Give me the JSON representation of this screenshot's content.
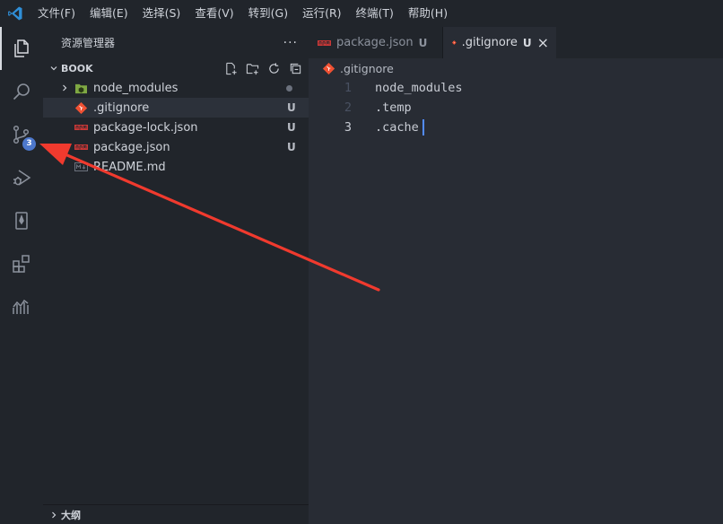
{
  "menu": {
    "items": [
      "文件(F)",
      "编辑(E)",
      "选择(S)",
      "查看(V)",
      "转到(G)",
      "运行(R)",
      "终端(T)",
      "帮助(H)"
    ]
  },
  "activity_bar": {
    "items": [
      {
        "icon": "explorer-icon",
        "active": true
      },
      {
        "icon": "search-icon",
        "active": false
      },
      {
        "icon": "source-control-icon",
        "active": false,
        "badge": "3"
      },
      {
        "icon": "run-debug-icon",
        "active": false
      },
      {
        "icon": "bookmark-icon",
        "active": false
      },
      {
        "icon": "extensions-icon",
        "active": false
      },
      {
        "icon": "stats-icon",
        "active": false
      }
    ],
    "badge": "3"
  },
  "sidebar": {
    "title": "资源管理器",
    "more": "···",
    "section": "BOOK",
    "files": [
      {
        "name": "node_modules",
        "type": "folder",
        "status": "dot"
      },
      {
        "name": ".gitignore",
        "type": "git",
        "status": "U",
        "selected": true
      },
      {
        "name": "package-lock.json",
        "type": "npm",
        "status": "U"
      },
      {
        "name": "package.json",
        "type": "npm",
        "status": "U"
      },
      {
        "name": "README.md",
        "type": "md",
        "status": ""
      }
    ],
    "outline": "大纲"
  },
  "editor": {
    "tabs": [
      {
        "label": "package.json",
        "status": "U",
        "active": false
      },
      {
        "label": ".gitignore",
        "status": "U",
        "active": true
      }
    ],
    "close": "×",
    "breadcrumb": ".gitignore",
    "lines": [
      {
        "num": "1",
        "text": "node_modules"
      },
      {
        "num": "2",
        "text": ".temp"
      },
      {
        "num": "3",
        "text": ".cache"
      }
    ]
  },
  "colors": {
    "accent": "#4d78cc",
    "arrow": "#f03a2e",
    "git": "#f05133",
    "npm": "#cb3837",
    "folder": "#8bc34a"
  }
}
